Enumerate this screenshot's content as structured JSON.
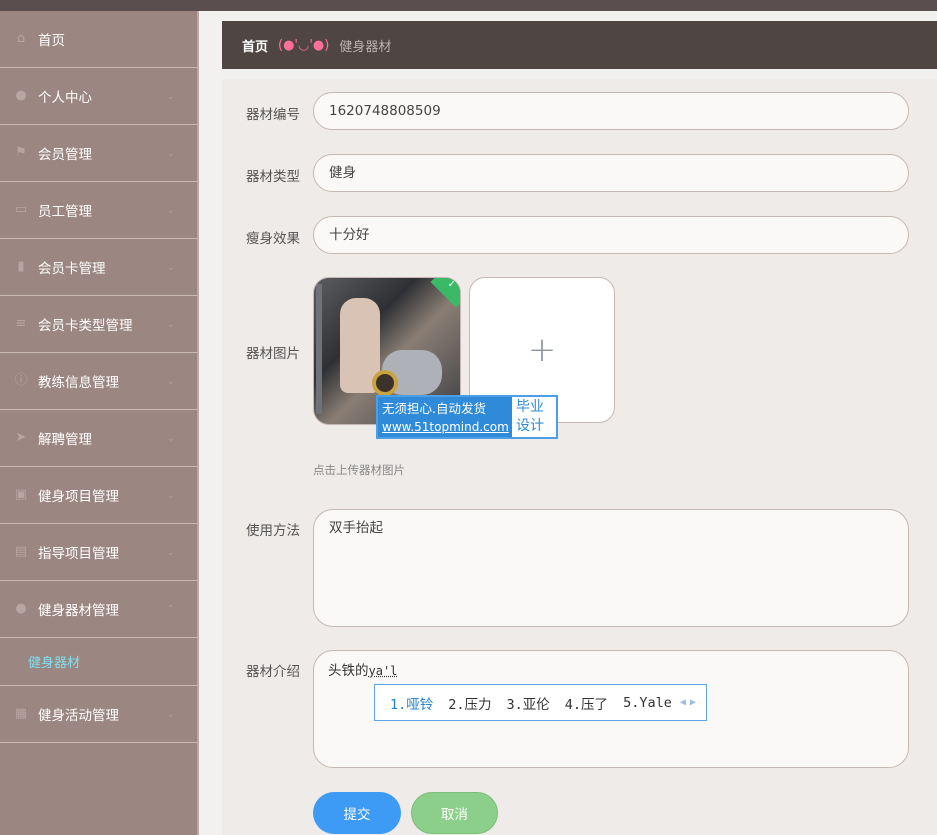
{
  "sidebar": {
    "items": [
      {
        "label": "首页",
        "icon": "home-icon",
        "glyph": "⌂"
      },
      {
        "label": "个人中心",
        "icon": "user-icon",
        "glyph": "●"
      },
      {
        "label": "会员管理",
        "icon": "flag-icon",
        "glyph": "⚑"
      },
      {
        "label": "员工管理",
        "icon": "monitor-icon",
        "glyph": "▭"
      },
      {
        "label": "会员卡管理",
        "icon": "chart-icon",
        "glyph": "▮"
      },
      {
        "label": "会员卡类型管理",
        "icon": "list-icon",
        "glyph": "≡"
      },
      {
        "label": "教练信息管理",
        "icon": "info-icon",
        "glyph": "ⓘ"
      },
      {
        "label": "解聘管理",
        "icon": "send-icon",
        "glyph": "➤"
      },
      {
        "label": "健身项目管理",
        "icon": "picture-icon",
        "glyph": "▣"
      },
      {
        "label": "指导项目管理",
        "icon": "document-icon",
        "glyph": "▤"
      },
      {
        "label": "健身器材管理",
        "icon": "user-icon",
        "glyph": "●"
      },
      {
        "label": "健身活动管理",
        "icon": "stack-icon",
        "glyph": "▦"
      }
    ],
    "sub_item": "健身器材"
  },
  "breadcrumb": {
    "home": "首页",
    "face": "(●'◡'●)",
    "current": "健身器材"
  },
  "form": {
    "code_label": "器材编号",
    "code_value": "1620748808509",
    "type_label": "器材类型",
    "type_value": "健身",
    "effect_label": "瘦身效果",
    "effect_value": "十分好",
    "image_label": "器材图片",
    "upload_hint": "点击上传器材图片",
    "usage_label": "使用方法",
    "usage_value": "双手抬起",
    "intro_label": "器材介绍",
    "intro_value": "头铁的",
    "intro_pinyin": "ya'l",
    "submit_label": "提交",
    "cancel_label": "取消"
  },
  "watermark": {
    "line1": "无须担心.自动发货",
    "line2": "www.51topmind.com",
    "right1": "毕业",
    "right2": "设计"
  },
  "ime": {
    "candidates": [
      "1.哑铃",
      "2.压力",
      "3.亚伦",
      "4.压了",
      "5.Yale"
    ]
  },
  "colors": {
    "sidebar": "#9c8682",
    "breadcrumb": "#4f4543",
    "submit": "#3d9bf5",
    "cancel": "#8bcf8a",
    "active_sub": "#7fe0ee"
  }
}
